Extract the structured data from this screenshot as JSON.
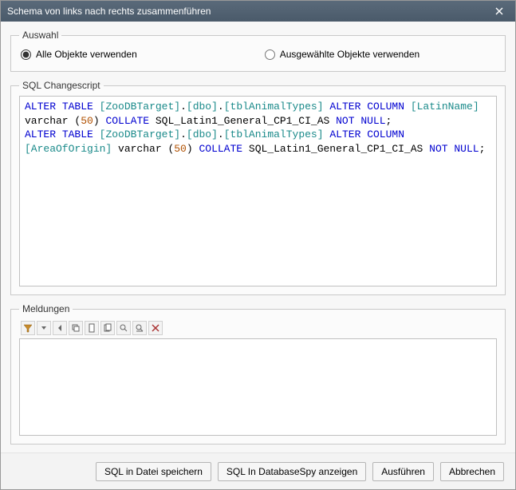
{
  "window": {
    "title": "Schema von links nach rechts zusammenführen"
  },
  "selection": {
    "legend": "Auswahl",
    "use_all_label": "Alle Objekte verwenden",
    "use_selected_label": "Ausgewählte Objekte verwenden",
    "use_all_checked": true
  },
  "sql": {
    "legend": "SQL Changescript",
    "tokens": [
      {
        "t": "kw",
        "v": "ALTER"
      },
      {
        "t": "sp",
        "v": " "
      },
      {
        "t": "kw",
        "v": "TABLE"
      },
      {
        "t": "sp",
        "v": " "
      },
      {
        "t": "ident",
        "v": "[ZooDBTarget]"
      },
      {
        "t": "plain",
        "v": "."
      },
      {
        "t": "ident",
        "v": "[dbo]"
      },
      {
        "t": "plain",
        "v": "."
      },
      {
        "t": "ident",
        "v": "[tblAnimalTypes]"
      },
      {
        "t": "sp",
        "v": " "
      },
      {
        "t": "kw",
        "v": "ALTER"
      },
      {
        "t": "sp",
        "v": " "
      },
      {
        "t": "kw",
        "v": "COLUMN"
      },
      {
        "t": "sp",
        "v": " "
      },
      {
        "t": "ident",
        "v": "[LatinName]"
      },
      {
        "t": "sp",
        "v": " "
      },
      {
        "t": "plain",
        "v": "varchar ("
      },
      {
        "t": "num",
        "v": "50"
      },
      {
        "t": "plain",
        "v": ") "
      },
      {
        "t": "kw",
        "v": "COLLATE"
      },
      {
        "t": "sp",
        "v": " "
      },
      {
        "t": "plain",
        "v": "SQL_Latin1_General_CP1_CI_AS "
      },
      {
        "t": "kw",
        "v": "NOT"
      },
      {
        "t": "sp",
        "v": " "
      },
      {
        "t": "kw",
        "v": "NULL"
      },
      {
        "t": "plain",
        "v": ";"
      },
      {
        "t": "nl",
        "v": "\n"
      },
      {
        "t": "kw",
        "v": "ALTER"
      },
      {
        "t": "sp",
        "v": " "
      },
      {
        "t": "kw",
        "v": "TABLE"
      },
      {
        "t": "sp",
        "v": " "
      },
      {
        "t": "ident",
        "v": "[ZooDBTarget]"
      },
      {
        "t": "plain",
        "v": "."
      },
      {
        "t": "ident",
        "v": "[dbo]"
      },
      {
        "t": "plain",
        "v": "."
      },
      {
        "t": "ident",
        "v": "[tblAnimalTypes]"
      },
      {
        "t": "sp",
        "v": " "
      },
      {
        "t": "kw",
        "v": "ALTER"
      },
      {
        "t": "sp",
        "v": " "
      },
      {
        "t": "kw",
        "v": "COLUMN"
      },
      {
        "t": "sp",
        "v": " "
      },
      {
        "t": "ident",
        "v": "[AreaOfOrigin]"
      },
      {
        "t": "sp",
        "v": " "
      },
      {
        "t": "plain",
        "v": "varchar ("
      },
      {
        "t": "num",
        "v": "50"
      },
      {
        "t": "plain",
        "v": ") "
      },
      {
        "t": "kw",
        "v": "COLLATE"
      },
      {
        "t": "sp",
        "v": " "
      },
      {
        "t": "plain",
        "v": "SQL_Latin1_General_CP1_CI_AS "
      },
      {
        "t": "kw",
        "v": "NOT"
      },
      {
        "t": "sp",
        "v": " "
      },
      {
        "t": "kw",
        "v": "NULL"
      },
      {
        "t": "plain",
        "v": ";"
      }
    ]
  },
  "messages": {
    "legend": "Meldungen",
    "toolbar_icons": [
      "filter-icon",
      "dropdown-icon",
      "prev-icon",
      "copy-icon",
      "doc-icon",
      "doc2-icon",
      "find-icon",
      "find2-icon",
      "clear-icon"
    ]
  },
  "buttons": {
    "save_sql": "SQL in Datei speichern",
    "show_in_dbspy": "SQL In DatabaseSpy anzeigen",
    "execute": "Ausführen",
    "cancel": "Abbrechen"
  }
}
